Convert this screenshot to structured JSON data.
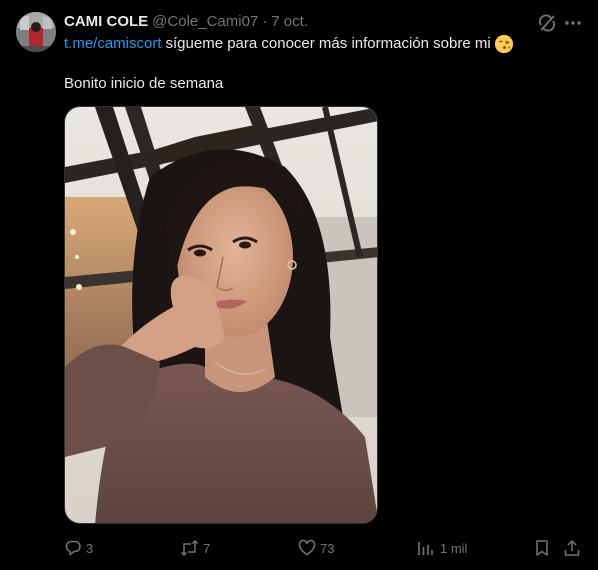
{
  "author": {
    "display_name": "CAMI COLE",
    "handle": "@Cole_Cami07",
    "separator": "·",
    "date": "7 oct."
  },
  "tweet": {
    "link_text": "t.me/camiscort",
    "line1_text": "sígueme para conocer más información sobre mi",
    "emoji": "face-blowing-kiss-emoji",
    "line2_text": "Bonito inicio de semana"
  },
  "actions": {
    "replies": "3",
    "reposts": "7",
    "likes": "73",
    "views": "1 mil"
  },
  "icons": {
    "grok": "grok-icon",
    "more": "more-icon",
    "reply": "reply-icon",
    "repost": "repost-icon",
    "like": "heart-icon",
    "views": "views-icon",
    "bookmark": "bookmark-icon",
    "share": "share-icon"
  },
  "colors": {
    "background": "#000000",
    "text": "#e7e9ea",
    "secondary": "#71767b",
    "link": "#1d9bf0"
  }
}
